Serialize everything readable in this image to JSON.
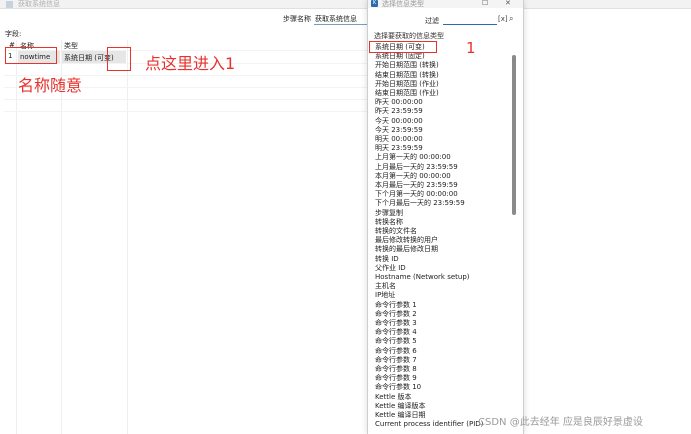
{
  "background_window": {
    "title": "获取系统信息",
    "step_name_label": "步骤名称",
    "step_name_value": "获取系统信息",
    "fields_label": "字段:",
    "columns": [
      "#",
      "名称",
      "类型"
    ],
    "rows": [
      {
        "num": "1",
        "name": "nowtime",
        "type": "系统日期 (可变)"
      }
    ]
  },
  "annotations": {
    "click_here": "点这里进入1",
    "name_any": "名称随意",
    "marker_1": "1"
  },
  "dialog": {
    "title": "选择信息类型",
    "maximize_icon": "square-icon",
    "close_icon": "close-icon",
    "filter_label": "过滤",
    "filter_value": "",
    "filter_clear": "[x]",
    "choose_label": "选择要获取的信息类型",
    "items": [
      "系统日期 (可变)",
      "系统日期 (固定)",
      "开始日期范围 (转换)",
      "结束日期范围 (转换)",
      "开始日期范围 (作业)",
      "结束日期范围 (作业)",
      "昨天 00:00:00",
      "昨天 23:59:59",
      "今天 00:00:00",
      "今天 23:59:59",
      "明天 00:00:00",
      "明天 23:59:59",
      "上月第一天的 00:00:00",
      "上月最后一天的 23:59:59",
      "本月第一天的 00:00:00",
      "本月最后一天的  23:59:59",
      "下个月第一天的 00:00:00",
      "下个月最后一天的 23:59:59",
      "步骤复制",
      "转换名称",
      "转换的文件名",
      "最后修改转换的用户",
      "转换的最后修改日期",
      "转换 ID",
      "父作业 ID",
      "Hostname (Network setup)",
      "主机名",
      "IP地址",
      "命令行参数 1",
      "命令行参数 2",
      "命令行参数 3",
      "命令行参数 4",
      "命令行参数 5",
      "命令行参数 6",
      "命令行参数 7",
      "命令行参数 8",
      "命令行参数 9",
      "命令行参数 10",
      "Kettle 版本",
      "Kettle 编译版本",
      "Kettle 编译日期",
      "Current process identifier (PID)"
    ]
  },
  "watermark": "CSDN @此去经年  应是良辰好景虚设",
  "colors": {
    "annotation_red": "#e8322e",
    "accent_blue": "#2b6cb0"
  }
}
